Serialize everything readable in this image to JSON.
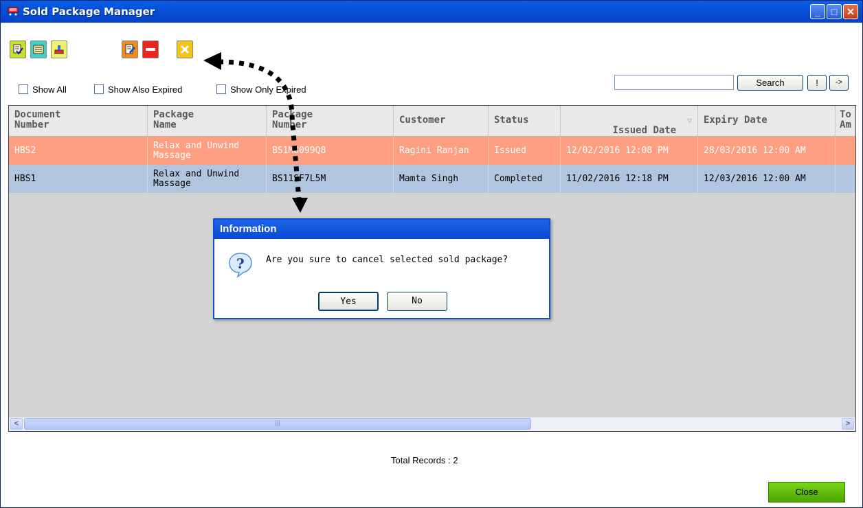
{
  "window": {
    "title": "Sold Package Manager"
  },
  "titlebar_buttons": [
    "minimize-icon",
    "maximize-icon",
    "close-icon"
  ],
  "toolbar": {
    "icons": [
      "new-sale-icon",
      "edit-record-icon",
      "import-icon",
      "edit-note-icon",
      "remove-icon",
      "cancel-icon"
    ]
  },
  "filters": {
    "show_all": {
      "label": "Show All",
      "checked": false
    },
    "show_also_expired": {
      "label": "Show Also Expired",
      "checked": false
    },
    "show_only_expired": {
      "label": "Show Only Expired",
      "checked": false
    }
  },
  "search": {
    "value": "",
    "button": "Search",
    "bang_button": "!",
    "arrow_button": "->"
  },
  "grid": {
    "columns": [
      "Document\nNumber",
      "Package\nName",
      "Package\nNumber",
      "Customer",
      "Status",
      "Issued Date",
      "Expiry Date",
      "To\nAm"
    ],
    "sort_indicator": "▽",
    "rows": [
      {
        "document_number": "HBS2",
        "package_name": "Relax and Unwind\nMassage",
        "package_number": "BS1M8099Q8",
        "customer": "Ragini Ranjan",
        "status": "Issued",
        "issued_date": "12/02/2016 12:08 PM",
        "expiry_date": "28/03/2016 12:00 AM",
        "selected": true
      },
      {
        "document_number": "HBS1",
        "package_name": "Relax and Unwind\nMassage",
        "package_number": "BS11SF7L5M",
        "customer": "Mamta Singh",
        "status": "Completed",
        "issued_date": "11/02/2016 12:18 PM",
        "expiry_date": "12/03/2016 12:00 AM",
        "selected": false
      }
    ],
    "scroll_left": "<",
    "scroll_right": ">",
    "scroll_grip": "|||"
  },
  "dialog": {
    "title": "Information",
    "message": "Are you sure to cancel selected sold package?",
    "yes": "Yes",
    "no": "No",
    "icon": "question-icon"
  },
  "footer": {
    "total_records": "Total Records : 2",
    "close": "Close"
  },
  "colors": {
    "selected_row": "#ff9f82",
    "alt_row": "#b1c6de",
    "titlebar": "#0550d8",
    "close_button": "#5fb800"
  }
}
